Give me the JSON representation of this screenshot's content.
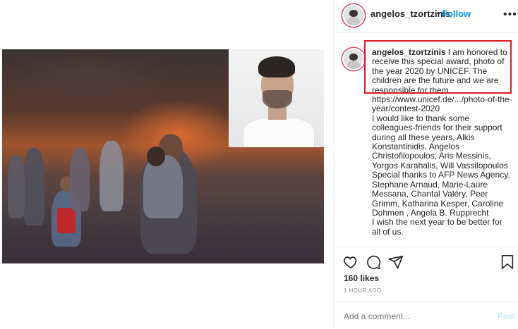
{
  "post": {
    "username": "angelos_tzortzinis",
    "follow_separator": "•",
    "follow_label": "Follow",
    "more_label": "•••",
    "caption_paragraphs": [
      "I am honored to receive this special award, photo of the year 2020 by UNICEF. The children are the future and we are responsible for them",
      "https://www.unicef.de/.../photo-of-the-year/contest-2020",
      "I would like to thank some colleagues-friends for their support during all these years, Alkis Konstantinidis, Angelos Christofilopoulos, Aris Messinis, Yorgos Karahalis, Will Vassilopoulos",
      "Special thanks to AFP News Agency, Stephane Arnaud, Marie-Laure Messana, Chantal Valéry, Peer Grimm, Katharina Kesper, Caroline Dohmen , Angela B. Rupprecht",
      "I wish the next year to be better for all of us."
    ],
    "likes": "160 likes",
    "timestamp": "1 HOUR AGO",
    "comment_placeholder": "Add a comment...",
    "post_label": "Post"
  },
  "icons": {
    "like": "heart-icon",
    "comment": "comment-icon",
    "share": "send-icon",
    "save": "bookmark-icon"
  },
  "colors": {
    "follow": "#0095f6",
    "highlight_box": "#e11b22",
    "post_disabled": "#b2dffc"
  }
}
